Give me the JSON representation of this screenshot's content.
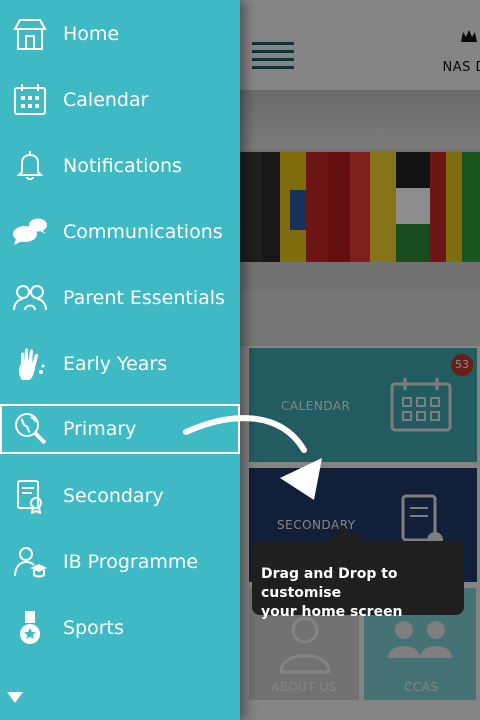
{
  "menu": {
    "items": [
      {
        "label": "Home",
        "icon": "home-icon"
      },
      {
        "label": "Calendar",
        "icon": "calendar-icon"
      },
      {
        "label": "Notifications",
        "icon": "bell-icon"
      },
      {
        "label": "Communications",
        "icon": "chat-icon"
      },
      {
        "label": "Parent Essentials",
        "icon": "parents-icon"
      },
      {
        "label": "Early Years",
        "icon": "handprint-icon"
      },
      {
        "label": "Primary",
        "icon": "globe-search-icon"
      },
      {
        "label": "Secondary",
        "icon": "certificate-icon"
      },
      {
        "label": "IB Programme",
        "icon": "graduate-icon"
      },
      {
        "label": "Sports",
        "icon": "medal-icon"
      }
    ],
    "selected": "Primary",
    "more_icon": "chevron-down-icon"
  },
  "header": {
    "logo_text": "NAS D"
  },
  "tiles": {
    "calendar": {
      "label": "CALENDAR",
      "badge": "53"
    },
    "secondary": {
      "label": "SECONDARY"
    },
    "about": {
      "label": "ABOUT US"
    },
    "ccas": {
      "label": "CCAS"
    }
  },
  "tooltip": {
    "text_line1": "Drag and Drop to customise",
    "text_line2": "your home screen"
  },
  "colors": {
    "drawer": "#3fbac5",
    "tile_teal": "#3fa7b0",
    "tile_navy": "#1f3b66",
    "badge": "#c0392b"
  }
}
